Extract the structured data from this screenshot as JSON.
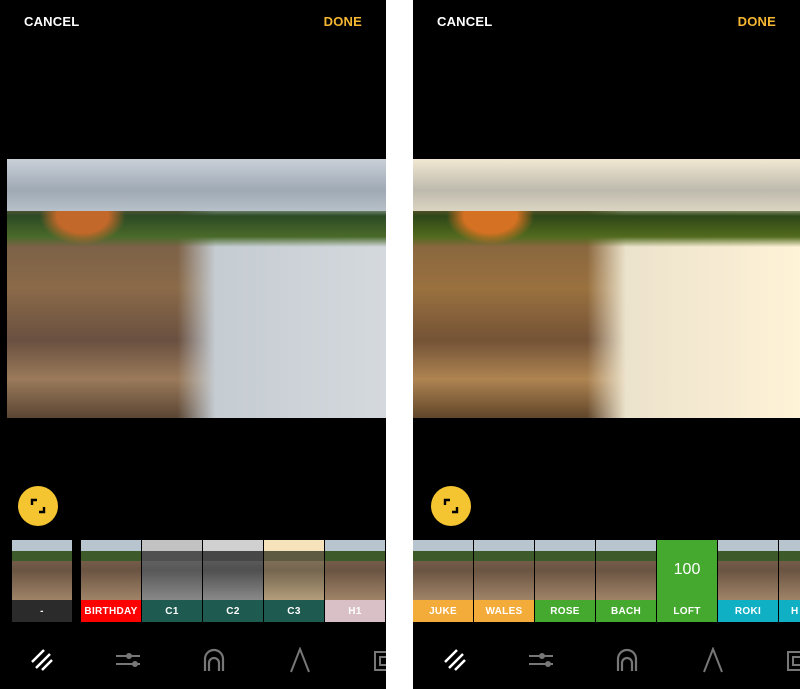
{
  "left": {
    "header": {
      "cancel": "CANCEL",
      "done": "DONE"
    },
    "filters": [
      {
        "label": "-",
        "color": "#2b2b2b"
      },
      {
        "label": "BIRTHDAY",
        "color": "#ff0000"
      },
      {
        "label": "C1",
        "color": "#1f5a50"
      },
      {
        "label": "C2",
        "color": "#1f5a50"
      },
      {
        "label": "C3",
        "color": "#1f5a50"
      },
      {
        "label": "H1",
        "color": "#d8c0c6"
      }
    ]
  },
  "right": {
    "header": {
      "cancel": "CANCEL",
      "done": "DONE"
    },
    "filters": [
      {
        "label": "JUKE",
        "color": "#f3ab3a"
      },
      {
        "label": "WALES",
        "color": "#f3ab3a"
      },
      {
        "label": "ROSE",
        "color": "#45a92f"
      },
      {
        "label": "BACH",
        "color": "#45a92f"
      },
      {
        "label": "LOFT",
        "color": "#45a92f",
        "selected": true,
        "strength": "100"
      },
      {
        "label": "ROKI",
        "color": "#0fb0c4"
      },
      {
        "label": "H",
        "color": "#0fb0c4"
      }
    ]
  },
  "toolbar_icons": [
    "filters-icon",
    "adjust-sliders-icon",
    "portrait-icon",
    "text-icon",
    "frame-icon"
  ],
  "accent": "#f5c431"
}
